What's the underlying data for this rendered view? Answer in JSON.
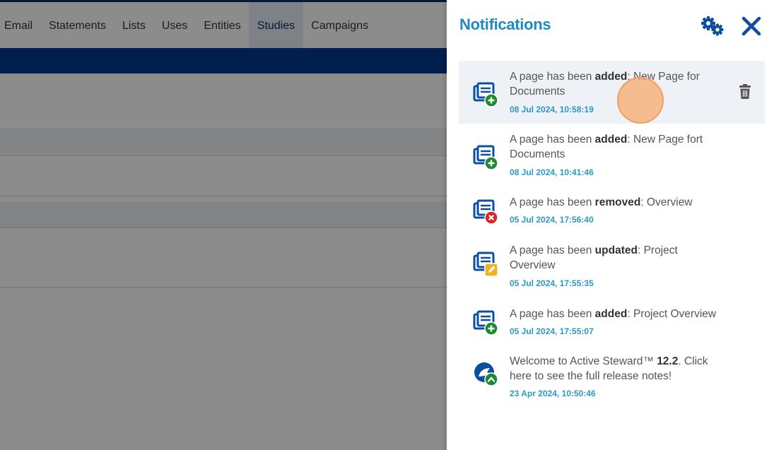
{
  "nav": {
    "items": [
      "Email",
      "Statements",
      "Lists",
      "Uses",
      "Entities",
      "Studies",
      "Campaigns"
    ],
    "active": "Studies"
  },
  "panel": {
    "title": "Notifications",
    "settings_icon": "gears-icon",
    "close_icon": "close-icon"
  },
  "notifications": [
    {
      "prefix": "A page has been ",
      "action": "added",
      "suffix": ": New Page for Documents",
      "time": "08 Jul 2024, 10:58:19",
      "badge": "add",
      "icon": "page-added-icon"
    },
    {
      "prefix": "A page has been ",
      "action": "added",
      "suffix": ": New Page fort Documents",
      "time": "08 Jul 2024, 10:41:46",
      "badge": "add",
      "icon": "page-added-icon"
    },
    {
      "prefix": "A page has been ",
      "action": "removed",
      "suffix": ": Overview",
      "time": "05 Jul 2024, 17:56:40",
      "badge": "remove",
      "icon": "page-removed-icon"
    },
    {
      "prefix": "A page has been ",
      "action": "updated",
      "suffix": ": Project Overview",
      "time": "05 Jul 2024, 17:55:35",
      "badge": "edit",
      "icon": "page-updated-icon"
    },
    {
      "prefix": "A page has been ",
      "action": "added",
      "suffix": ": Project Overview",
      "time": "05 Jul 2024, 17:55:07",
      "badge": "add",
      "icon": "page-added-icon"
    },
    {
      "prefix": "Welcome to Active Steward™ ",
      "action": "12.2",
      "suffix": ". Click here to see the full release notes!",
      "time": "23 Apr 2024, 10:50:46",
      "badge": "up",
      "icon": "release-notes-icon"
    }
  ],
  "colors": {
    "accent": "#1f8ac0",
    "timestamp": "#2b98c9",
    "icon_blue": "#0d4f9e",
    "badge_green": "#1c8a2e",
    "badge_red": "#d62828",
    "badge_yellow": "#f2b11d"
  }
}
